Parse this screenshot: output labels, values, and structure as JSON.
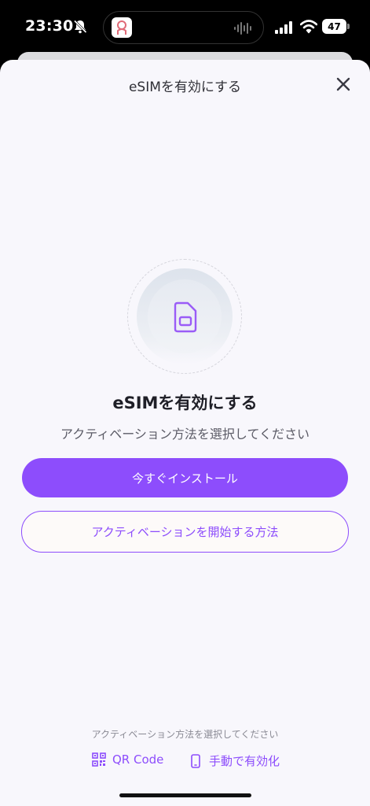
{
  "status_bar": {
    "time": "23:30",
    "battery": "47",
    "icons": [
      "bell-slash-icon",
      "signal-icon",
      "wifi-icon",
      "battery-icon"
    ]
  },
  "sheet": {
    "header_title": "eSIMを有効にする",
    "close_icon": "close-icon"
  },
  "illustration": {
    "icon": "sim-card-icon",
    "accent": "#8d4dfc"
  },
  "content": {
    "title": "eSIMを有効にする",
    "subtitle": "アクティベーション方法を選択してください"
  },
  "buttons": {
    "install_now": "今すぐインストール",
    "how_to_activate": "アクティベーションを開始する方法"
  },
  "footer": {
    "note": "アクティベーション方法を選択してください",
    "qr_label": "QR Code",
    "qr_icon": "qr-code-icon",
    "manual_label": "手動で有効化",
    "manual_icon": "phone-icon"
  },
  "colors": {
    "accent": "#8d4dfc",
    "sheet_bg": "#f8f7fc"
  }
}
